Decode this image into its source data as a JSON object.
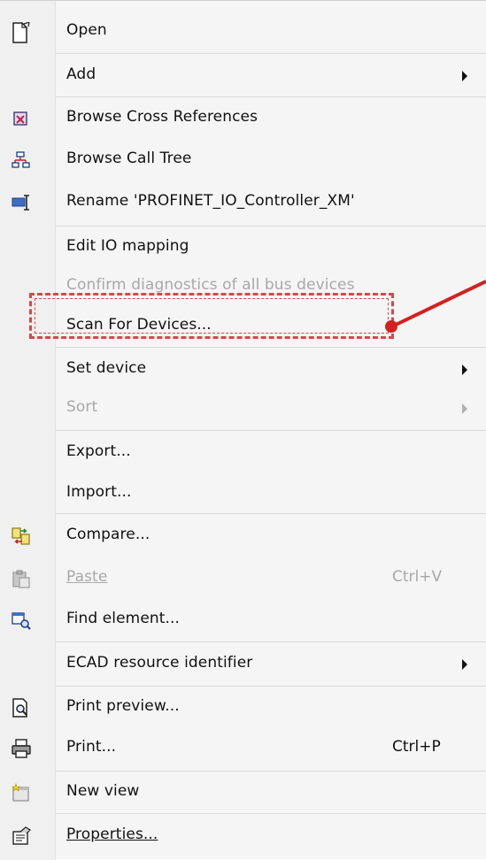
{
  "menu": {
    "items": [
      {
        "label": "Open",
        "icon": "open-document-icon",
        "enabled": true
      },
      {
        "label": "Add",
        "submenu": true,
        "enabled": true
      },
      {
        "label": "Browse Cross References",
        "icon": "cross-references-icon",
        "enabled": true
      },
      {
        "label": "Browse Call Tree",
        "icon": "call-tree-icon",
        "enabled": true
      },
      {
        "label": "Rename 'PROFINET_IO_Controller_XM'",
        "icon": "rename-icon",
        "enabled": true
      },
      {
        "label": "Edit IO mapping",
        "enabled": true
      },
      {
        "label": "Confirm diagnostics of all bus devices",
        "enabled": false
      },
      {
        "label": "Scan For Devices...",
        "enabled": true,
        "highlighted": true
      },
      {
        "label": "Set device",
        "submenu": true,
        "enabled": true
      },
      {
        "label": "Sort",
        "submenu": true,
        "enabled": false
      },
      {
        "label": "Export...",
        "enabled": true
      },
      {
        "label": "Import...",
        "enabled": true
      },
      {
        "label": "Compare...",
        "icon": "compare-icon",
        "enabled": true
      },
      {
        "label": "Paste",
        "icon": "paste-icon",
        "shortcut": "Ctrl+V",
        "enabled": false
      },
      {
        "label": "Find element...",
        "icon": "find-element-icon",
        "enabled": true
      },
      {
        "label": "ECAD resource identifier",
        "submenu": true,
        "enabled": true
      },
      {
        "label": "Print preview...",
        "icon": "print-preview-icon",
        "enabled": true
      },
      {
        "label": "Print...",
        "icon": "printer-icon",
        "shortcut": "Ctrl+P",
        "enabled": true
      },
      {
        "label": "New view",
        "icon": "new-view-icon",
        "enabled": true
      },
      {
        "label": "Properties...",
        "icon": "properties-icon",
        "enabled": true
      }
    ]
  },
  "colors": {
    "menu_background": "#f5f5f5",
    "text": "#111111",
    "disabled_text": "#a8a8a8",
    "annotation_red": "#d42020"
  }
}
